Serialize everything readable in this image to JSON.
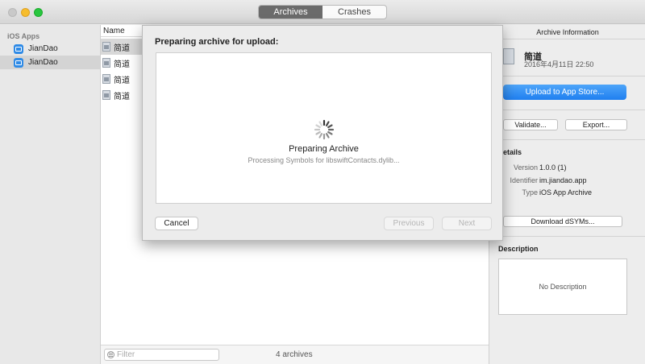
{
  "titlebar": {
    "tabs": [
      {
        "label": "Archives",
        "active": true
      },
      {
        "label": "Crashes",
        "active": false
      }
    ]
  },
  "sidebar": {
    "header": "iOS Apps",
    "items": [
      {
        "label": "JianDao",
        "selected": false
      },
      {
        "label": "JianDao",
        "selected": true
      }
    ]
  },
  "list": {
    "column_header": "Name",
    "rows": [
      "简道",
      "简道",
      "简道",
      "简道"
    ],
    "filter_placeholder": "Filter",
    "footer_count": "4 archives"
  },
  "info": {
    "header": "Archive Information",
    "app_name": "简道",
    "app_date": "2016年4月11日 22:50",
    "upload_label": "Upload to App Store...",
    "validate_label": "Validate...",
    "export_label": "Export...",
    "details_title": "etails",
    "details": [
      {
        "key": "Version",
        "value": "1.0.0 (1)"
      },
      {
        "key": "Identifier",
        "value": "im.jiandao.app"
      },
      {
        "key": "Type",
        "value": "iOS App Archive"
      }
    ],
    "download_dsyms_label": "Download dSYMs...",
    "description_title": "Description",
    "description_placeholder": "No Description"
  },
  "sheet": {
    "title": "Preparing archive for upload:",
    "status": "Preparing Archive",
    "substatus": "Processing Symbols for libswiftContacts.dylib...",
    "cancel_label": "Cancel",
    "previous_label": "Previous",
    "next_label": "Next"
  },
  "colors": {
    "accent": "#1f7ff0",
    "selection": "#d4d4d4",
    "close": "#c9c9c9",
    "minimize": "#f6bd2e",
    "maximize": "#29c640"
  }
}
